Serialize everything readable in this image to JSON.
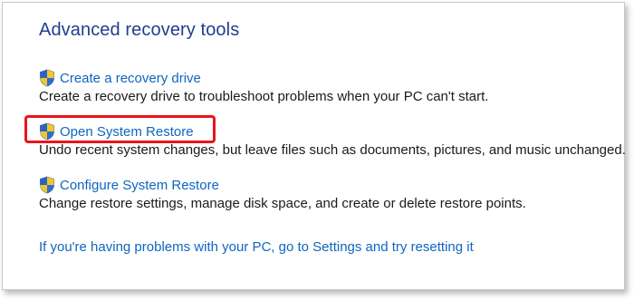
{
  "page": {
    "title": "Advanced recovery tools"
  },
  "items": [
    {
      "link": "Create a recovery drive",
      "icon": "uac-shield-icon",
      "description": "Create a recovery drive to troubleshoot problems when your PC can't start."
    },
    {
      "link": "Open System Restore",
      "icon": "uac-shield-icon",
      "description": "Undo recent system changes, but leave files such as documents, pictures, and music unchanged."
    },
    {
      "link": "Configure System Restore",
      "icon": "uac-shield-icon",
      "description": "Change restore settings, manage disk space, and create or delete restore points."
    }
  ],
  "footer": {
    "link": "If you're having problems with your PC, go to Settings and try resetting it"
  },
  "colors": {
    "title": "#1e3f8c",
    "link": "#0e66c0",
    "highlight": "#e8151b"
  }
}
